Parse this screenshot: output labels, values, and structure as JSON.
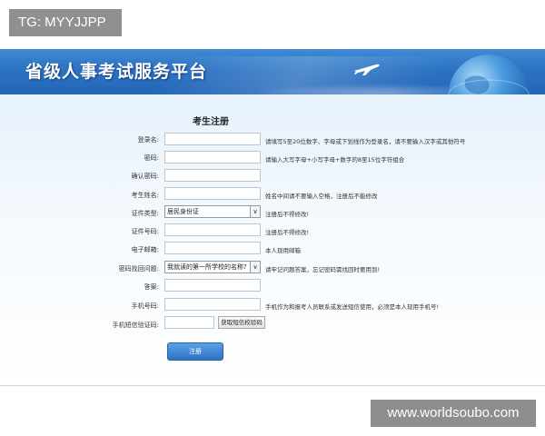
{
  "watermark": {
    "tag": "TG: MYYJJPP",
    "site": "www.worldsoubo.com"
  },
  "banner": {
    "title": "省级人事考试服务平台"
  },
  "form": {
    "title": "考生注册",
    "fields": {
      "login_name": {
        "label": "登录名:",
        "hint": "请填写5至20位数字、字母或下划线作为登录名，请不要输入汉字或其他符号"
      },
      "password": {
        "label": "密码:",
        "hint": "请输入大写字母+小写字母+数字的8至15位字符组合"
      },
      "confirm_password": {
        "label": "确认密码:"
      },
      "candidate_name": {
        "label": "考生姓名:",
        "hint": "姓名中间请不要输入空格，注册后不能修改"
      },
      "id_type": {
        "label": "证件类型:",
        "value": "居民身份证",
        "hint": "注册后不得修改!"
      },
      "id_number": {
        "label": "证件号码:",
        "hint": "注册后不得修改!"
      },
      "email": {
        "label": "电子邮箱:",
        "hint": "本人现用邮箱"
      },
      "security_question": {
        "label": "密码找回问题:",
        "value": "我就读的第一所学校的名称?",
        "hint": "请牢记问题答案，忘记密码需找回时要用到!"
      },
      "answer": {
        "label": "答案:"
      },
      "phone": {
        "label": "手机号码:",
        "hint": "手机作为和报考人员联系或发送短信使用，必须是本人现用手机号!"
      },
      "sms_code": {
        "label": "手机短信验证码:",
        "button": "获取短信校验码"
      }
    },
    "submit": "注册"
  }
}
